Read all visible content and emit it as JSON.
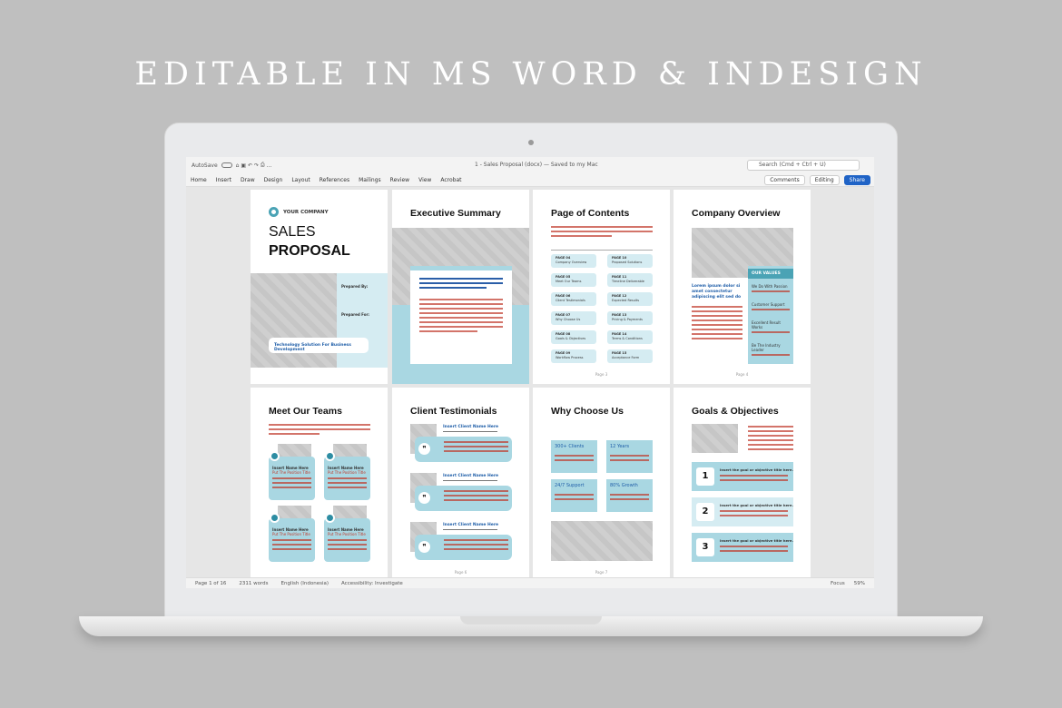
{
  "headline": "EDITABLE IN MS WORD & INDESIGN",
  "word": {
    "autosave": "AutoSave",
    "doc_title": "1 - Sales Proposal (docx) — Saved to my Mac",
    "search": "Search (Cmd + Ctrl + U)",
    "menu": [
      "Home",
      "Insert",
      "Draw",
      "Design",
      "Layout",
      "References",
      "Mailings",
      "Review",
      "View",
      "Acrobat"
    ],
    "comments": "Comments",
    "editing": "Editing",
    "share": "Share"
  },
  "status": {
    "page": "Page 1 of 16",
    "words": "2311 words",
    "language": "English (Indonesia)",
    "accessibility": "Accessibility: Investigate",
    "focus": "Focus",
    "zoom": "59%"
  },
  "cover": {
    "company": "YOUR COMPANY",
    "title1": "SALES",
    "title2": "PROPOSAL",
    "prepared_by": "Prepared By:",
    "prepared_for": "Prepared For:",
    "tagline": "Technology Solution For Business Development"
  },
  "pages": {
    "exec": "Executive Summary",
    "contents": "Page of Contents",
    "overview": "Company Overview",
    "values": "OUR VALUES",
    "values_items": [
      "Customer Support",
      "Excellent Result Works",
      "Be The Industry Leader"
    ],
    "values_first": "We Do With Passion",
    "lorem": "Lorem ipsum dolor si amet consectetur adipiscing elit sed do",
    "teams": "Meet Our Teams",
    "member_name": "Insert Name Here",
    "member_title": "Put The Position Title",
    "testimonials": "Client Testimonials",
    "client_name": "Insert Client Name Here",
    "why": "Why Choose Us",
    "why_stats": [
      "300+ Clients",
      "12 Years",
      "24/7 Support",
      "80% Growth"
    ],
    "goals": "Goals & Objectives",
    "goal_text": "Insert the goal or objective title here.",
    "goal_nums": [
      "1",
      "2",
      "3"
    ]
  },
  "toc": {
    "left": [
      [
        "PAGE 04",
        "Company Overview"
      ],
      [
        "PAGE 05",
        "Meet Our Teams"
      ],
      [
        "PAGE 06",
        "Client Testimonials"
      ],
      [
        "PAGE 07",
        "Why Choose Us"
      ],
      [
        "PAGE 08",
        "Goals & Objectives"
      ],
      [
        "PAGE 09",
        "Workflow Process"
      ]
    ],
    "right": [
      [
        "PAGE 10",
        "Proposed Solutions"
      ],
      [
        "PAGE 11",
        "Timeline Deliverable"
      ],
      [
        "PAGE 12",
        "Expected Results"
      ],
      [
        "PAGE 13",
        "Pricing & Payments"
      ],
      [
        "PAGE 14",
        "Terms & Conditions"
      ],
      [
        "PAGE 15",
        "Acceptance Form"
      ]
    ]
  }
}
